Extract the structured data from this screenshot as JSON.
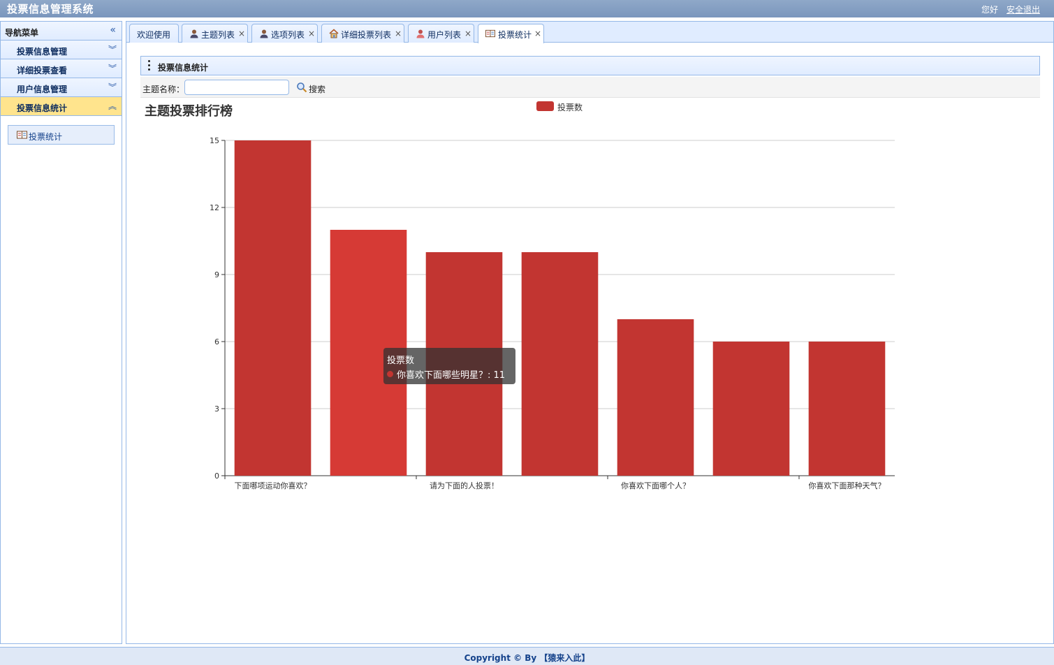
{
  "header": {
    "title": "投票信息管理系统",
    "greeting": "您好",
    "logout": "安全退出"
  },
  "sidebar": {
    "title": "导航菜单",
    "collapse_icon": "double-chevron-left-icon",
    "sections": [
      {
        "label": "投票信息管理",
        "active": false
      },
      {
        "label": "详细投票查看",
        "active": false
      },
      {
        "label": "用户信息管理",
        "active": false
      },
      {
        "label": "投票信息统计",
        "active": true
      }
    ],
    "links": [
      {
        "label": "投票统计",
        "icon": "book-icon"
      }
    ]
  },
  "tabs": [
    {
      "label": "欢迎使用",
      "icon": "",
      "closable": false
    },
    {
      "label": "主题列表",
      "icon": "user-icon",
      "closable": true
    },
    {
      "label": "选项列表",
      "icon": "user-icon",
      "closable": true
    },
    {
      "label": "详细投票列表",
      "icon": "home-icon",
      "closable": true
    },
    {
      "label": "用户列表",
      "icon": "user-female-icon",
      "closable": true
    },
    {
      "label": "投票统计",
      "icon": "book-icon",
      "closable": true,
      "selected": true
    }
  ],
  "tab_close": "×",
  "panel": {
    "title": "投票信息统计"
  },
  "search": {
    "label": "主题名称：",
    "value": "",
    "placeholder": "",
    "button": "搜索"
  },
  "tooltip": {
    "title": "投票数",
    "line": "你喜欢下面哪些明星？: 11"
  },
  "footer": {
    "text": "Copyright © By 【猿来入此】"
  },
  "chart_data": {
    "type": "bar",
    "title": "主题投票排行榜",
    "legend": [
      "投票数"
    ],
    "legend_position": "top-center",
    "series": [
      {
        "name": "投票数",
        "values": [
          15,
          11,
          10,
          10,
          7,
          6,
          6
        ],
        "color": "#c23531"
      }
    ],
    "categories": [
      "下面哪项运动你喜欢？",
      "你喜欢下面哪些明星？",
      "请为下面的人投票！",
      "",
      "你喜欢下面哪个人？",
      "",
      "你喜欢下面那种天气？"
    ],
    "visible_category_labels": [
      "下面哪项运动你喜欢？",
      "请为下面的人投票！",
      "你喜欢下面哪个人？",
      "你喜欢下面那种天气？"
    ],
    "ylim": [
      0,
      15
    ],
    "yticks": [
      0,
      3,
      6,
      9,
      12,
      15
    ],
    "grid": true,
    "highlighted_index": 1,
    "highlight_color": "#d63a35"
  }
}
